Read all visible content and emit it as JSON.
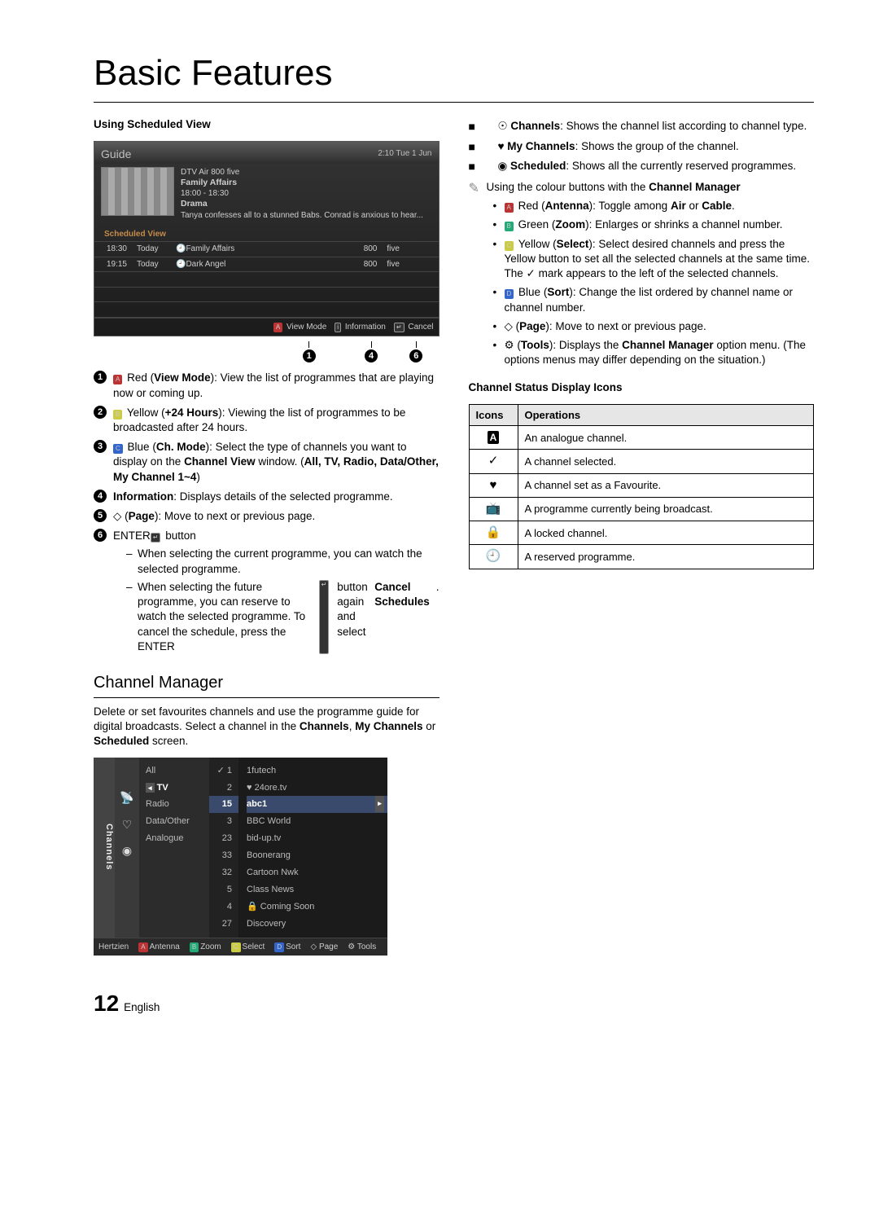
{
  "title": "Basic Features",
  "left": {
    "subhead": "Using Scheduled View",
    "guide": {
      "title": "Guide",
      "clock": "2:10 Tue 1 Jun",
      "channel_line": "DTV Air 800 five",
      "prog_name": "Family Affairs",
      "time_range": "18:00 - 18:30",
      "genre": "Drama",
      "synopsis": "Tanya confesses all to a stunned Babs. Conrad is anxious to hear...",
      "sv_label": "Scheduled View",
      "rows": [
        {
          "time": "18:30",
          "day": "Today",
          "prog": "Family Affairs",
          "num": "800",
          "ch": "five"
        },
        {
          "time": "19:15",
          "day": "Today",
          "prog": "Dark Angel",
          "num": "800",
          "ch": "five"
        }
      ],
      "foot": {
        "view": "View Mode",
        "info": "Information",
        "cancel": "Cancel"
      }
    },
    "markers": {
      "m1": "1",
      "m4": "4",
      "m6": "6"
    },
    "items": [
      {
        "n": "1",
        "pre": "A",
        "body_pre": "Red (",
        "bold": "View Mode",
        "body_post": "): View the list of programmes that are playing now or coming up."
      },
      {
        "n": "2",
        "pre": "B",
        "body_pre": "Yellow (",
        "bold": "+24 Hours",
        "body_post": "): Viewing the list of programmes to be broadcasted after 24 hours."
      },
      {
        "n": "3",
        "pre": "C",
        "body_pre": "Blue (",
        "bold": "Ch. Mode",
        "body_post": "): Select the type of channels you want to display on the ",
        "bold2": "Channel View",
        "body_post2": " window. (",
        "bold3": "All, TV, Radio, Data/Other, My Channel 1~4",
        "body_post3": ")"
      },
      {
        "n": "4",
        "bold": "Information",
        "body_post": ": Displays details of the selected programme."
      },
      {
        "n": "5",
        "pre": "◇",
        "body_pre": "(",
        "bold": "Page",
        "body_post": "): Move to next or previous page."
      },
      {
        "n": "6",
        "body_pre": "ENTER",
        "enter": "↵",
        "body_post": " button"
      }
    ],
    "sub6": [
      "When selecting the current programme, you can watch the selected programme.",
      {
        "a": "When selecting the future programme, you can reserve to watch the selected programme. To cancel the schedule, press the ENTER",
        "enter": "↵",
        "b": " button again and select ",
        "bold": "Cancel Schedules",
        "c": "."
      }
    ],
    "cm_title": "Channel Manager",
    "cm_intro_a": "Delete or set favourites channels and use the programme guide for digital broadcasts. Select a channel in the ",
    "cm_intro_b1": "Channels",
    "cm_intro_c": ", ",
    "cm_intro_b2": "My Channels",
    "cm_intro_d": " or ",
    "cm_intro_b3": "Scheduled",
    "cm_intro_e": " screen.",
    "cm": {
      "side": "Channels",
      "cats": [
        "All",
        "TV",
        "Radio",
        "Data/Other",
        "Analogue"
      ],
      "rows": [
        {
          "n": "1",
          "name": "1futech",
          "mark": "✓"
        },
        {
          "n": "2",
          "name": "24ore.tv",
          "fav": "♥"
        },
        {
          "n": "15",
          "name": "abc1",
          "hl": true
        },
        {
          "n": "3",
          "name": "BBC World"
        },
        {
          "n": "23",
          "name": "bid-up.tv"
        },
        {
          "n": "33",
          "name": "Boonerang"
        },
        {
          "n": "32",
          "name": "Cartoon Nwk"
        },
        {
          "n": "5",
          "name": "Class News"
        },
        {
          "n": "4",
          "name": "Coming Soon",
          "lock": "🔒"
        },
        {
          "n": "27",
          "name": "Discovery"
        }
      ],
      "foot": {
        "src": "Hertzien",
        "a": "Antenna",
        "b": "Zoom",
        "c": "Select",
        "d": "Sort",
        "page": "Page",
        "tools": "Tools"
      }
    }
  },
  "right": {
    "bitems": [
      {
        "icon": "☉",
        "bold": "Channels",
        "txt": ": Shows the channel list according to channel type."
      },
      {
        "icon": "♥",
        "bold": "My Channels",
        "txt": ": Shows the group of the channel."
      },
      {
        "icon": "◉",
        "bold": "Scheduled",
        "txt": ": Shows all the currently reserved programmes."
      }
    ],
    "note_a": "Using the colour buttons with the ",
    "note_b": "Channel Manager",
    "dlist": [
      {
        "key": "A",
        "pre": "Red (",
        "bold": "Antenna",
        "mid": "): Toggle among ",
        "b2": "Air",
        "mid2": " or ",
        "b3": "Cable",
        "post": "."
      },
      {
        "key": "B",
        "pre": "Green (",
        "bold": "Zoom",
        "post": "): Enlarges or shrinks a channel number."
      },
      {
        "key": "C",
        "pre": "Yellow (",
        "bold": "Select",
        "post": "): Select desired channels and press the Yellow button to set all the selected channels at the same time. The ✓ mark appears to the left of the selected channels."
      },
      {
        "key": "D",
        "pre": "Blue (",
        "bold": "Sort",
        "post": "): Change the list ordered by channel name or channel number."
      },
      {
        "pre": "◇ (",
        "bold": "Page",
        "post": "): Move to next or previous page."
      },
      {
        "pre": "⚙ (",
        "bold": "Tools",
        "post": "): Displays the ",
        "b2": "Channel Manager",
        "post2": " option menu. (The options menus may differ depending on the situation.)"
      }
    ],
    "icons_head": "Channel Status Display Icons",
    "icons_th1": "Icons",
    "icons_th2": "Operations",
    "icons": [
      {
        "i": "A",
        "boxed": true,
        "t": "An analogue channel."
      },
      {
        "i": "✓",
        "t": "A channel selected."
      },
      {
        "i": "♥",
        "t": "A channel set as a Favourite."
      },
      {
        "i": "📺",
        "t": "A programme currently being broadcast."
      },
      {
        "i": "🔒",
        "t": "A locked channel."
      },
      {
        "i": "🕘",
        "t": "A reserved programme."
      }
    ]
  },
  "footer": {
    "num": "12",
    "lang": "English"
  }
}
